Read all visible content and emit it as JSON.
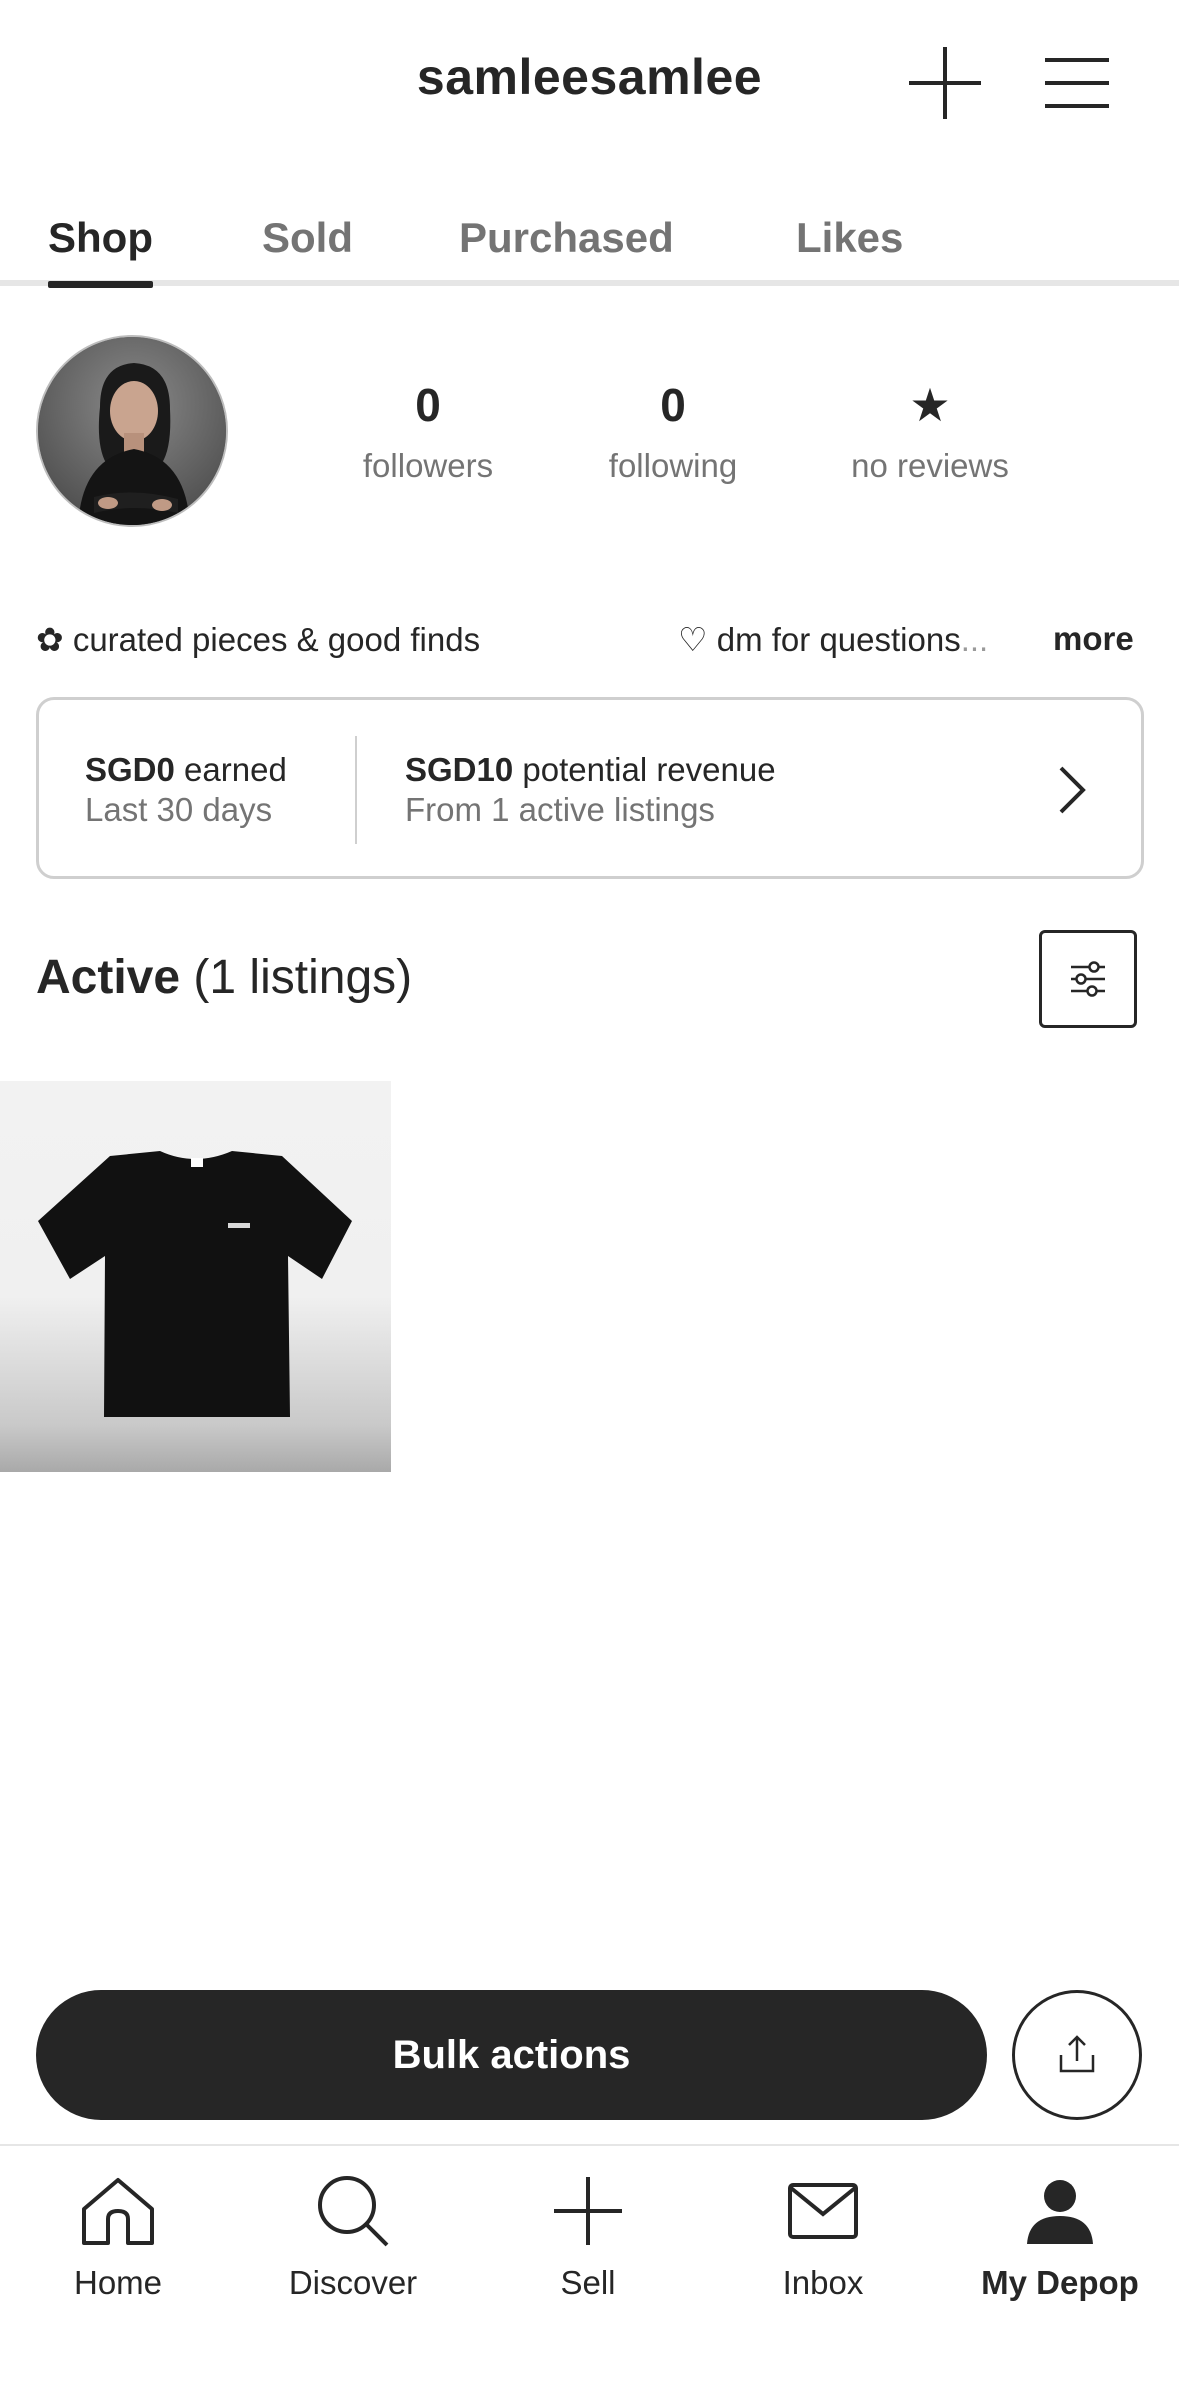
{
  "header": {
    "username": "samleesamlee",
    "add_icon": "plus-icon",
    "menu_icon": "hamburger-menu-icon"
  },
  "tabs": [
    {
      "label": "Shop",
      "active": true
    },
    {
      "label": "Sold",
      "active": false
    },
    {
      "label": "Purchased",
      "active": false
    },
    {
      "label": "Likes",
      "active": false
    }
  ],
  "profile": {
    "stats": {
      "followers": {
        "value": "0",
        "label": "followers"
      },
      "following": {
        "value": "0",
        "label": "following"
      },
      "reviews": {
        "value": "★",
        "label": "no reviews"
      }
    },
    "bio_line1": "✿ curated pieces & good finds",
    "bio_line2": "♡ dm for questions",
    "bio_ellipsis": "...",
    "more_label": "more"
  },
  "revenue": {
    "earned_amount": "SGD0",
    "earned_label": " earned",
    "earned_period": "Last 30 days",
    "potential_amount": "SGD10",
    "potential_label": " potential revenue",
    "potential_sub": "From 1 active listings"
  },
  "active": {
    "title": "Active",
    "count_text": " (1 listings)"
  },
  "listings": [
    {
      "type": "t-shirt",
      "color": "#111111"
    }
  ],
  "actions": {
    "bulk_label": "Bulk actions",
    "share_icon": "share-icon"
  },
  "nav": [
    {
      "label": "Home",
      "icon": "home-icon"
    },
    {
      "label": "Discover",
      "icon": "search-icon"
    },
    {
      "label": "Sell",
      "icon": "plus-icon"
    },
    {
      "label": "Inbox",
      "icon": "mail-icon"
    },
    {
      "label": "My Depop",
      "icon": "profile-icon",
      "active": true
    }
  ],
  "colors": {
    "text": "#262626",
    "muted": "#747474",
    "border": "#cfcfcf",
    "button": "#262626"
  }
}
